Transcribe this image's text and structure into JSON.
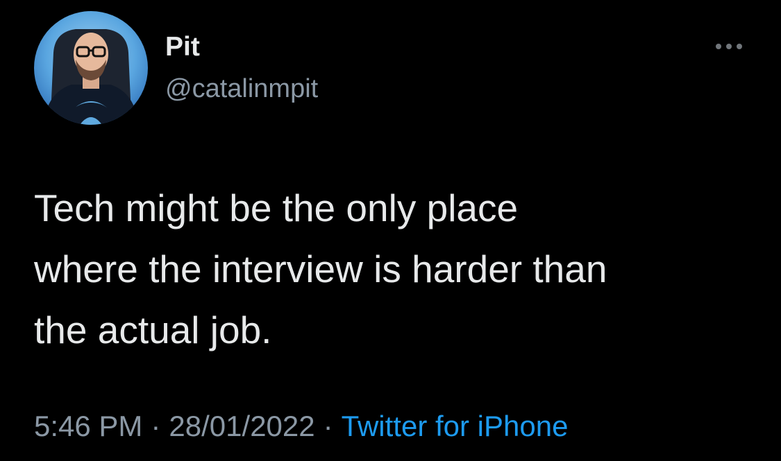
{
  "user": {
    "display_name": "Pit",
    "handle": "@catalinmpit",
    "avatar_icon": "profile-photo"
  },
  "more_icon": "more-horizontal-icon",
  "tweet": {
    "text": "Tech might be the only place\nwhere the interview is harder than\nthe actual job."
  },
  "meta": {
    "time": "5:46 PM",
    "separator": "·",
    "date": "28/01/2022",
    "source": "Twitter for iPhone"
  },
  "colors": {
    "background": "#000000",
    "text_primary": "#e7e9ea",
    "text_secondary": "#8b98a5",
    "link": "#1d9bf0"
  }
}
